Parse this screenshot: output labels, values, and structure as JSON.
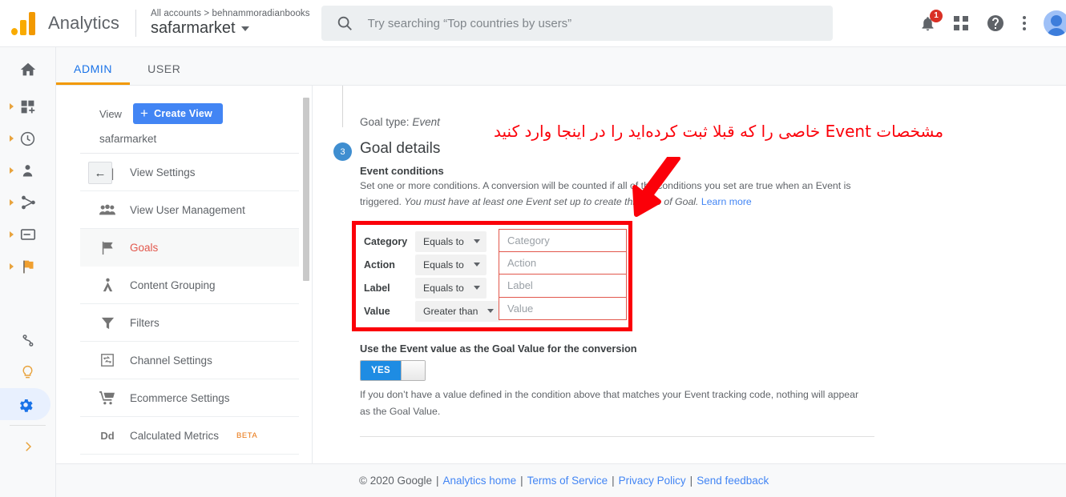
{
  "topbar": {
    "brand": "Analytics",
    "account_breadcrumb": "All accounts > behnammoradianbooks",
    "property_name": "safarmarket",
    "search_placeholder": "Try searching “Top countries by users”",
    "notification_count": "1",
    "icons": [
      "search-icon",
      "notifications-icon",
      "apps-grid-icon",
      "help-icon",
      "more-options-icon",
      "avatar"
    ]
  },
  "rail": {
    "items": [
      {
        "name": "home",
        "expandable": false
      },
      {
        "name": "customization",
        "expandable": true
      },
      {
        "name": "realtime",
        "expandable": true
      },
      {
        "name": "audience",
        "expandable": true
      },
      {
        "name": "acquisition",
        "expandable": true
      },
      {
        "name": "behavior",
        "expandable": true
      },
      {
        "name": "conversions",
        "expandable": true
      },
      {
        "name": "attribution",
        "expandable": false
      },
      {
        "name": "discover",
        "expandable": false
      },
      {
        "name": "admin",
        "expandable": false,
        "active": true
      },
      {
        "name": "expand-rail",
        "expandable": false
      }
    ]
  },
  "tabs": [
    {
      "label": "ADMIN",
      "selected": true
    },
    {
      "label": "USER",
      "selected": false
    }
  ],
  "panel": {
    "column_label": "View",
    "create_button": "Create View",
    "view_name": "safarmarket",
    "collapse_icon": "←",
    "items": [
      {
        "label": "View Settings",
        "icon": "document-icon",
        "selected": false
      },
      {
        "label": "View User Management",
        "icon": "people-icon",
        "selected": false
      },
      {
        "label": "Goals",
        "icon": "flag-icon",
        "selected": true
      },
      {
        "label": "Content Grouping",
        "icon": "content-grouping-icon",
        "selected": false
      },
      {
        "label": "Filters",
        "icon": "filter-icon",
        "selected": false
      },
      {
        "label": "Channel Settings",
        "icon": "channel-settings-icon",
        "selected": false
      },
      {
        "label": "Ecommerce Settings",
        "icon": "cart-icon",
        "selected": false
      },
      {
        "label": "Calculated Metrics",
        "icon": "dd-icon",
        "badge": "BETA",
        "selected": false
      }
    ]
  },
  "main": {
    "goal_type_label": "Goal type:",
    "goal_type_value": "Event",
    "step_number": "3",
    "section_title": "Goal details",
    "event_conditions_title": "Event conditions",
    "event_conditions_desc_1": "Set one or more conditions. A conversion will be counted if all of the conditions you set are true when an Event is triggered. ",
    "event_conditions_desc_italic": "You must have at least one Event set up to create this type of Goal.",
    "learn_more": "Learn more",
    "conditions": [
      {
        "label": "Category",
        "operator": "Equals to",
        "placeholder": "Category",
        "value": ""
      },
      {
        "label": "Action",
        "operator": "Equals to",
        "placeholder": "Action",
        "value": ""
      },
      {
        "label": "Label",
        "operator": "Equals to",
        "placeholder": "Label",
        "value": ""
      },
      {
        "label": "Value",
        "operator": "Greater than",
        "placeholder": "Value",
        "value": ""
      }
    ],
    "toggle_title": "Use the Event value as the Goal Value for the conversion",
    "toggle_state": "YES",
    "toggle_desc": "If you don’t have a value defined in the condition above that matches your Event tracking code, nothing will appear as the Goal Value."
  },
  "footer": {
    "copyright": "© 2020 Google",
    "links": [
      "Analytics home",
      "Terms of Service",
      "Privacy Policy",
      "Send feedback"
    ]
  },
  "annotation": {
    "text": "مشخصات Event خاصی را که قبلا ثبت کرده‌اید را در اینجا وارد کنید",
    "color": "#fb0009",
    "arrow": "down-left-arrow",
    "highlight_box": "conditions-box"
  }
}
